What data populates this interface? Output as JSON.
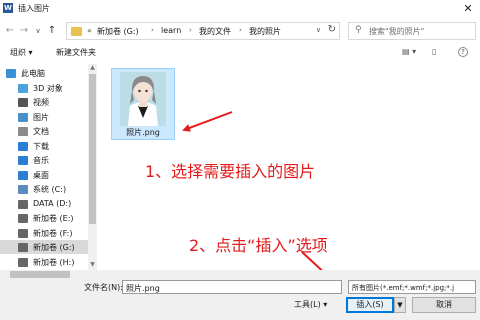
{
  "window": {
    "app_icon_letter": "W",
    "title": "插入图片",
    "close_glyph": "✕"
  },
  "address_bar": {
    "back_glyph": "←",
    "forward_glyph": "→",
    "recent_glyph": "∨",
    "up_glyph": "↑",
    "overflow_glyph": "«",
    "crumbs": [
      "新加卷 (G:)",
      "learn",
      "我的文件",
      "我的照片"
    ],
    "separator_glyph": "›",
    "dropdown_glyph": "∨",
    "refresh_glyph": "↻",
    "search_placeholder": "搜索\"我的照片\""
  },
  "toolbar": {
    "organize_label": "组织 ▾",
    "new_folder_label": "新建文件夹",
    "view_glyph": "▤ ▾",
    "preview_glyph": "▯",
    "help_glyph": "?"
  },
  "nav_pane": {
    "items": [
      {
        "label": "此电脑",
        "icon": "computer-icon",
        "color": "#3a8fd6",
        "root": true,
        "selected": false
      },
      {
        "label": "3D 对象",
        "icon": "3d-objects-icon",
        "color": "#4aa3df",
        "root": false,
        "selected": false
      },
      {
        "label": "视频",
        "icon": "video-icon",
        "color": "#555555",
        "root": false,
        "selected": false
      },
      {
        "label": "图片",
        "icon": "pictures-icon",
        "color": "#4a90c8",
        "root": false,
        "selected": false
      },
      {
        "label": "文档",
        "icon": "documents-icon",
        "color": "#8a8a8a",
        "root": false,
        "selected": false
      },
      {
        "label": "下载",
        "icon": "downloads-icon",
        "color": "#2a7fd4",
        "root": false,
        "selected": false
      },
      {
        "label": "音乐",
        "icon": "music-icon",
        "color": "#2a7fd4",
        "root": false,
        "selected": false
      },
      {
        "label": "桌面",
        "icon": "desktop-icon",
        "color": "#2a7fd4",
        "root": false,
        "selected": false
      },
      {
        "label": "系统 (C:)",
        "icon": "system-drive-icon",
        "color": "#5a8ac0",
        "root": false,
        "selected": false
      },
      {
        "label": "DATA (D:)",
        "icon": "drive-icon",
        "color": "#666666",
        "root": false,
        "selected": false
      },
      {
        "label": "新加卷 (E:)",
        "icon": "drive-icon",
        "color": "#666666",
        "root": false,
        "selected": false
      },
      {
        "label": "新加卷 (F:)",
        "icon": "drive-icon",
        "color": "#666666",
        "root": false,
        "selected": false
      },
      {
        "label": "新加卷 (G:)",
        "icon": "drive-icon",
        "color": "#666666",
        "root": false,
        "selected": true
      },
      {
        "label": "新加卷 (H:)",
        "icon": "drive-icon",
        "color": "#666666",
        "root": false,
        "selected": false
      }
    ]
  },
  "content": {
    "files": [
      {
        "name": "照片.png",
        "icon": "image-thumbnail"
      }
    ]
  },
  "annotations": {
    "step1": "1、选择需要插入的图片",
    "step2": "2、点击“插入”选项",
    "color": "#e41b1b"
  },
  "bottom_bar": {
    "filename_label": "文件名(N):",
    "filename_value": "照片.png",
    "filetype_value": "所有图片(*.emf;*.wmf;*.jpg;*.j",
    "tools_label": "工具(L) ▾",
    "insert_label": "插入(S)",
    "insert_split_glyph": "▼",
    "cancel_label": "取消"
  }
}
